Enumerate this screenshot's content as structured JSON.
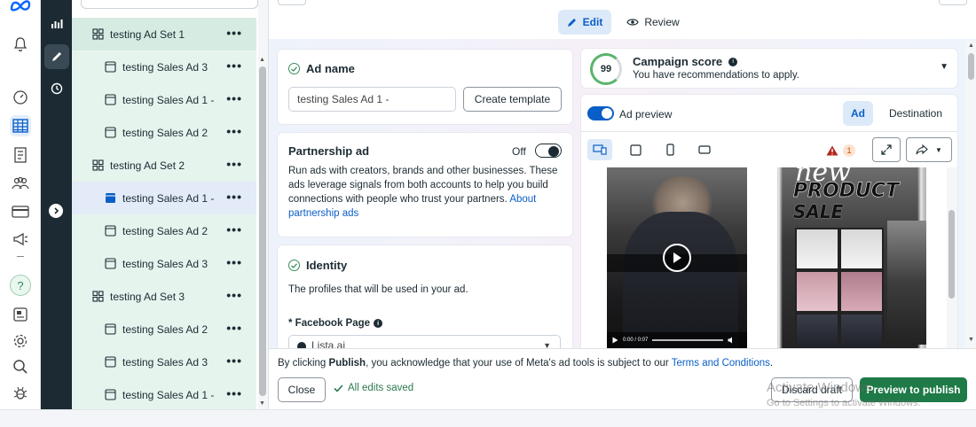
{
  "tree": {
    "items": [
      {
        "label": "testing Ad Set 1",
        "kind": "set"
      },
      {
        "label": "testing Sales Ad 3",
        "kind": "ad"
      },
      {
        "label": "testing Sales Ad 1 -",
        "kind": "ad"
      },
      {
        "label": "testing Sales Ad 2",
        "kind": "ad"
      },
      {
        "label": "testing Ad Set 2",
        "kind": "set"
      },
      {
        "label": "testing Sales Ad 1 -",
        "kind": "ad",
        "selected": true
      },
      {
        "label": "testing Sales Ad 2",
        "kind": "ad"
      },
      {
        "label": "testing Sales Ad 3",
        "kind": "ad"
      },
      {
        "label": "testing Ad Set 3",
        "kind": "set"
      },
      {
        "label": "testing Sales Ad 2",
        "kind": "ad"
      },
      {
        "label": "testing Sales Ad 3",
        "kind": "ad"
      },
      {
        "label": "testing Sales Ad 1 -",
        "kind": "ad"
      }
    ],
    "more_label": "•••"
  },
  "topbar": {
    "edit_label": "Edit",
    "review_label": "Review"
  },
  "ad_name": {
    "title": "Ad name",
    "value": "testing Sales Ad 1 -",
    "template_button": "Create template"
  },
  "partnership": {
    "title": "Partnership ad",
    "toggle_label": "Off",
    "toggle_on": false,
    "description": "Run ads with creators, brands and other businesses. These ads leverage signals from both accounts to help you build connections with people who trust your partners.",
    "link": "About partnership ads"
  },
  "identity": {
    "title": "Identity",
    "description": "The profiles that will be used in your ad.",
    "fb_page_label": "* Facebook Page",
    "fb_page_value": "Lista.ai"
  },
  "campaign_score": {
    "score": "99",
    "title": "Campaign score",
    "subtitle": "You have recommendations to apply."
  },
  "preview": {
    "toggle_label": "Ad preview",
    "toggle_on": true,
    "tab_ad": "Ad",
    "tab_destination": "Destination",
    "warning_count": "1",
    "video_time": "0:00 / 0:07",
    "creative_headline_top": "new",
    "creative_headline_1": "PRODUCT",
    "creative_headline_2": "SALE"
  },
  "bottom": {
    "notice_prefix": "By clicking ",
    "notice_bold": "Publish",
    "notice_middle": ", you acknowledge that your use of Meta's ad tools is subject to our ",
    "notice_link": "Terms and Conditions",
    "notice_suffix": ".",
    "close_label": "Close",
    "saved_label": "All edits saved",
    "discard_label": "Discard draft",
    "publish_label": "Preview to publish"
  },
  "watermark": {
    "line1": "Activate Windows",
    "line2": "Go to Settings to activate Windows."
  },
  "colors": {
    "accent_blue": "#0a5ec7",
    "publish_green": "#1e7a47",
    "tree_green": "#e6f4ee",
    "dark_rail": "#1c2b33"
  }
}
